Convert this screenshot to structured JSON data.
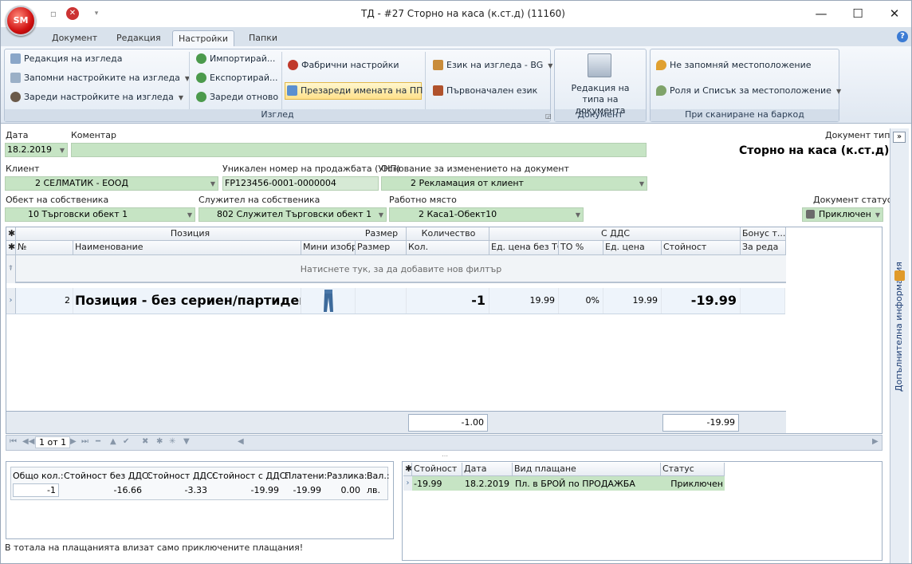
{
  "window": {
    "logo": "SM",
    "title": "ТД - #27 Сторно на каса (к.ст.д) (11160)",
    "minimize": "—",
    "maximize": "☐",
    "close": "✕"
  },
  "tabs": [
    "Документ",
    "Редакция",
    "Настройки",
    "Папки"
  ],
  "ribbon": {
    "group_view": {
      "title": "Изглед",
      "col1": [
        "Редакция на изгледа",
        "Запомни настройките на изгледа",
        "Зареди настройките на изгледа"
      ],
      "col2": [
        "Импортирай...",
        "Експортирай...",
        "Зареди отново"
      ],
      "col3": [
        "Фабрични настройки",
        "Презареди имената на ПП"
      ],
      "col4": [
        "Език на изгледа - BG",
        "Първоначален език"
      ]
    },
    "group_document": {
      "title": "Документ",
      "button": "Редакция на типа на документа"
    },
    "group_barcode": {
      "title": "При сканиране на баркод",
      "items": [
        "Не запомняй местоположение",
        "Роля и Списък за местоположение"
      ]
    }
  },
  "form": {
    "date_label": "Дата",
    "date_value": "18.2.2019",
    "comment_label": "Коментар",
    "comment_value": "",
    "doc_type_label": "Документ тип",
    "doc_type_value": "Сторно на каса (к.ст.д)",
    "client_label": "Клиент",
    "client_id": "2",
    "client_name": "СЕЛМАТИК - ЕООД",
    "unp_label": "Уникален номер на продажбата (УНП)",
    "unp_value": "FP123456-0001-0000004",
    "reason_label": "Основание за изменението на документ",
    "reason_id": "2",
    "reason_name": "Рекламация от клиент",
    "object_label": "Обект на собственика",
    "object_id": "10",
    "object_name": "Търговски обект 1",
    "employee_label": "Служител на собственика",
    "employee_id": "802",
    "employee_name": "Служител Търговски обект 1",
    "workplace_label": "Работно място",
    "workplace_id": "2",
    "workplace_name": "Каса1-Обект10",
    "status_label": "Документ статус",
    "status_value": "Приключен"
  },
  "grid": {
    "bands": [
      "Позиция",
      "Размер",
      "Количество",
      "С ДДС",
      "Бонус т..."
    ],
    "columns": [
      "№",
      "Наименование",
      "Мини изобр.",
      "Размер",
      "Кол.",
      "Ед. цена без ТО",
      "ТО %",
      "Ед. цена",
      "Стойност",
      "За реда"
    ],
    "filter_hint": "Натиснете тук, за да добавите нов филтър",
    "rows": [
      {
        "no": "2",
        "name": "Позиция - без сериен/партиден...",
        "size": "",
        "qty": "-1",
        "price_no_to": "19.99",
        "to_pct": "0%",
        "price": "19.99",
        "value": "-19.99"
      }
    ],
    "summary_qty": "-1.00",
    "summary_value": "-19.99"
  },
  "navigator": {
    "page": "1 от 1"
  },
  "totals": {
    "headers": [
      "Общо кол.:",
      "Стойност без ДДС:",
      "Стойност ДДС:",
      "Стойност с ДДС:",
      "Платени:",
      "Разлика:",
      "Вал.:"
    ],
    "values": [
      "-1",
      "-16.66",
      "-3.33",
      "-19.99",
      "-19.99",
      "0.00",
      "лв."
    ],
    "note": "В тотала на плащанията влизат само приключените плащания!"
  },
  "payments": {
    "columns": [
      "Стойност",
      "Дата",
      "Вид плащане",
      "Статус"
    ],
    "rows": [
      {
        "value": "-19.99",
        "date": "18.2.2019",
        "type": "Пл. в БРОЙ по ПРОДАЖБА",
        "status": "Приключен"
      }
    ]
  },
  "side_panel": {
    "label": "Допълнителна информация",
    "toggle": "»"
  }
}
